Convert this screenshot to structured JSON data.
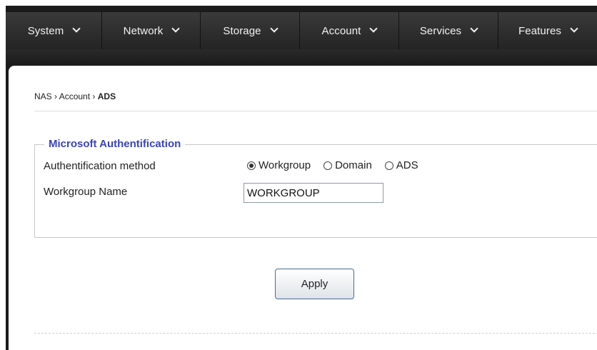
{
  "nav": [
    {
      "label": "System"
    },
    {
      "label": "Network"
    },
    {
      "label": "Storage"
    },
    {
      "label": "Account"
    },
    {
      "label": "Services"
    },
    {
      "label": "Features"
    }
  ],
  "breadcrumb": {
    "part1": "NAS",
    "sep": "›",
    "part2": "Account",
    "current": "ADS"
  },
  "section": {
    "legend": "Microsoft Authentification"
  },
  "form": {
    "method_label": "Authentification method",
    "options": [
      {
        "label": "Workgroup",
        "checked": true
      },
      {
        "label": "Domain",
        "checked": false
      },
      {
        "label": "ADS",
        "checked": false
      }
    ],
    "workgroup_label": "Workgroup Name",
    "workgroup_value": "WORKGROUP"
  },
  "apply_label": "Apply"
}
